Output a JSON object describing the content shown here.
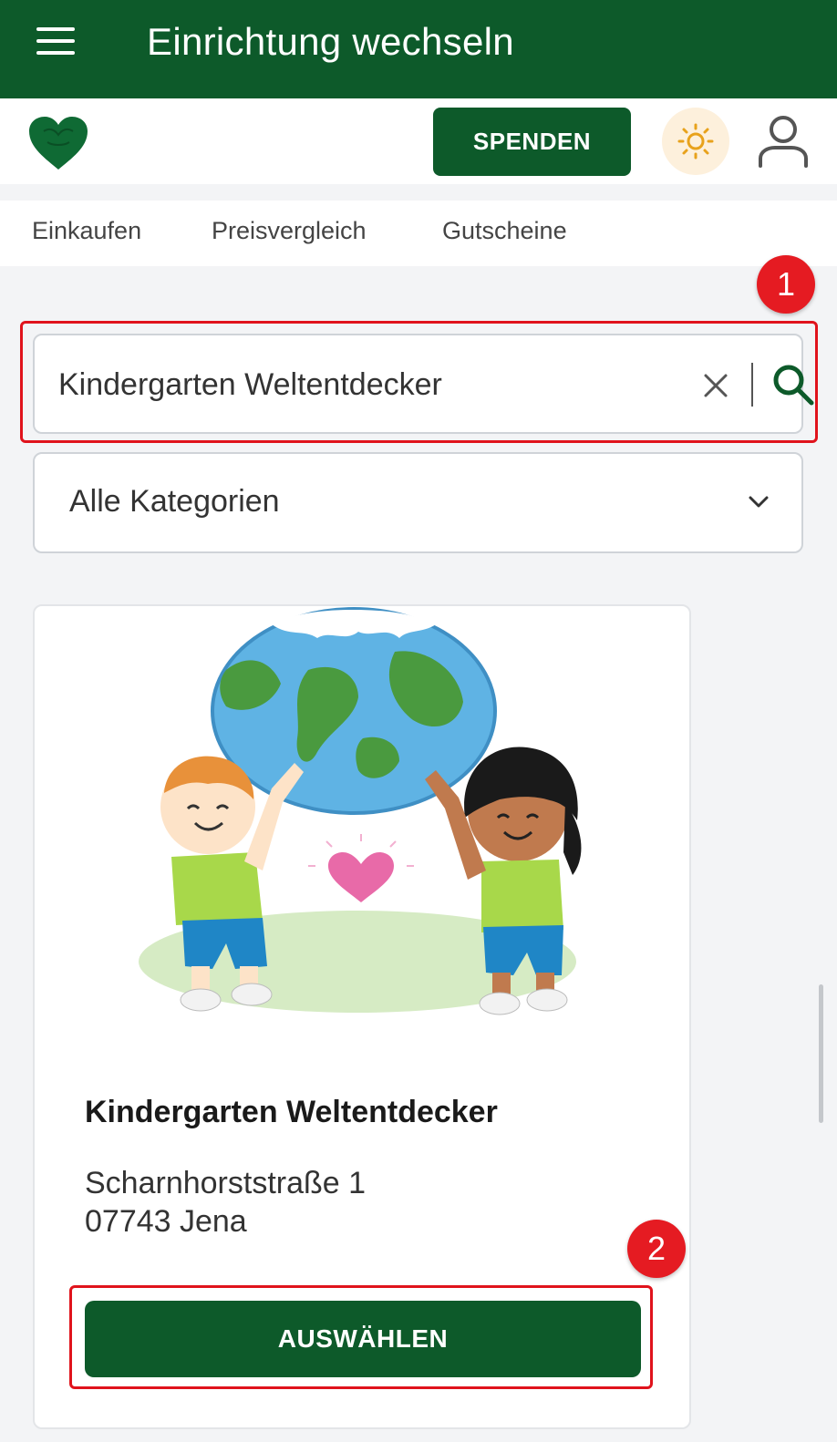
{
  "topbar": {
    "title": "Einrichtung wechseln",
    "menu_icon": "hamburger-menu-icon"
  },
  "header": {
    "logo_icon": "heart-logo-icon",
    "spenden_label": "SPENDEN",
    "theme_icon": "sun-icon",
    "profile_icon": "user-icon"
  },
  "tabs": [
    {
      "label": "Einkaufen"
    },
    {
      "label": "Preisvergleich"
    },
    {
      "label": "Gutscheine"
    }
  ],
  "search": {
    "value": "Kindergarten Weltentdecker",
    "clear_icon": "close-icon",
    "search_icon": "search-icon"
  },
  "category": {
    "selected": "Alle Kategorien",
    "icon": "chevron-down-icon"
  },
  "result": {
    "name": "Kindergarten Weltentdecker",
    "street": "Scharnhorststraße 1",
    "city": "07743 Jena",
    "button_label": "AUSWÄHLEN",
    "image": "kids-holding-globe-illustration"
  },
  "annotations": [
    {
      "number": "1"
    },
    {
      "number": "2"
    }
  ],
  "colors": {
    "primary": "#0d5a2a",
    "annotation": "#e51b22",
    "background": "#f3f4f6"
  }
}
